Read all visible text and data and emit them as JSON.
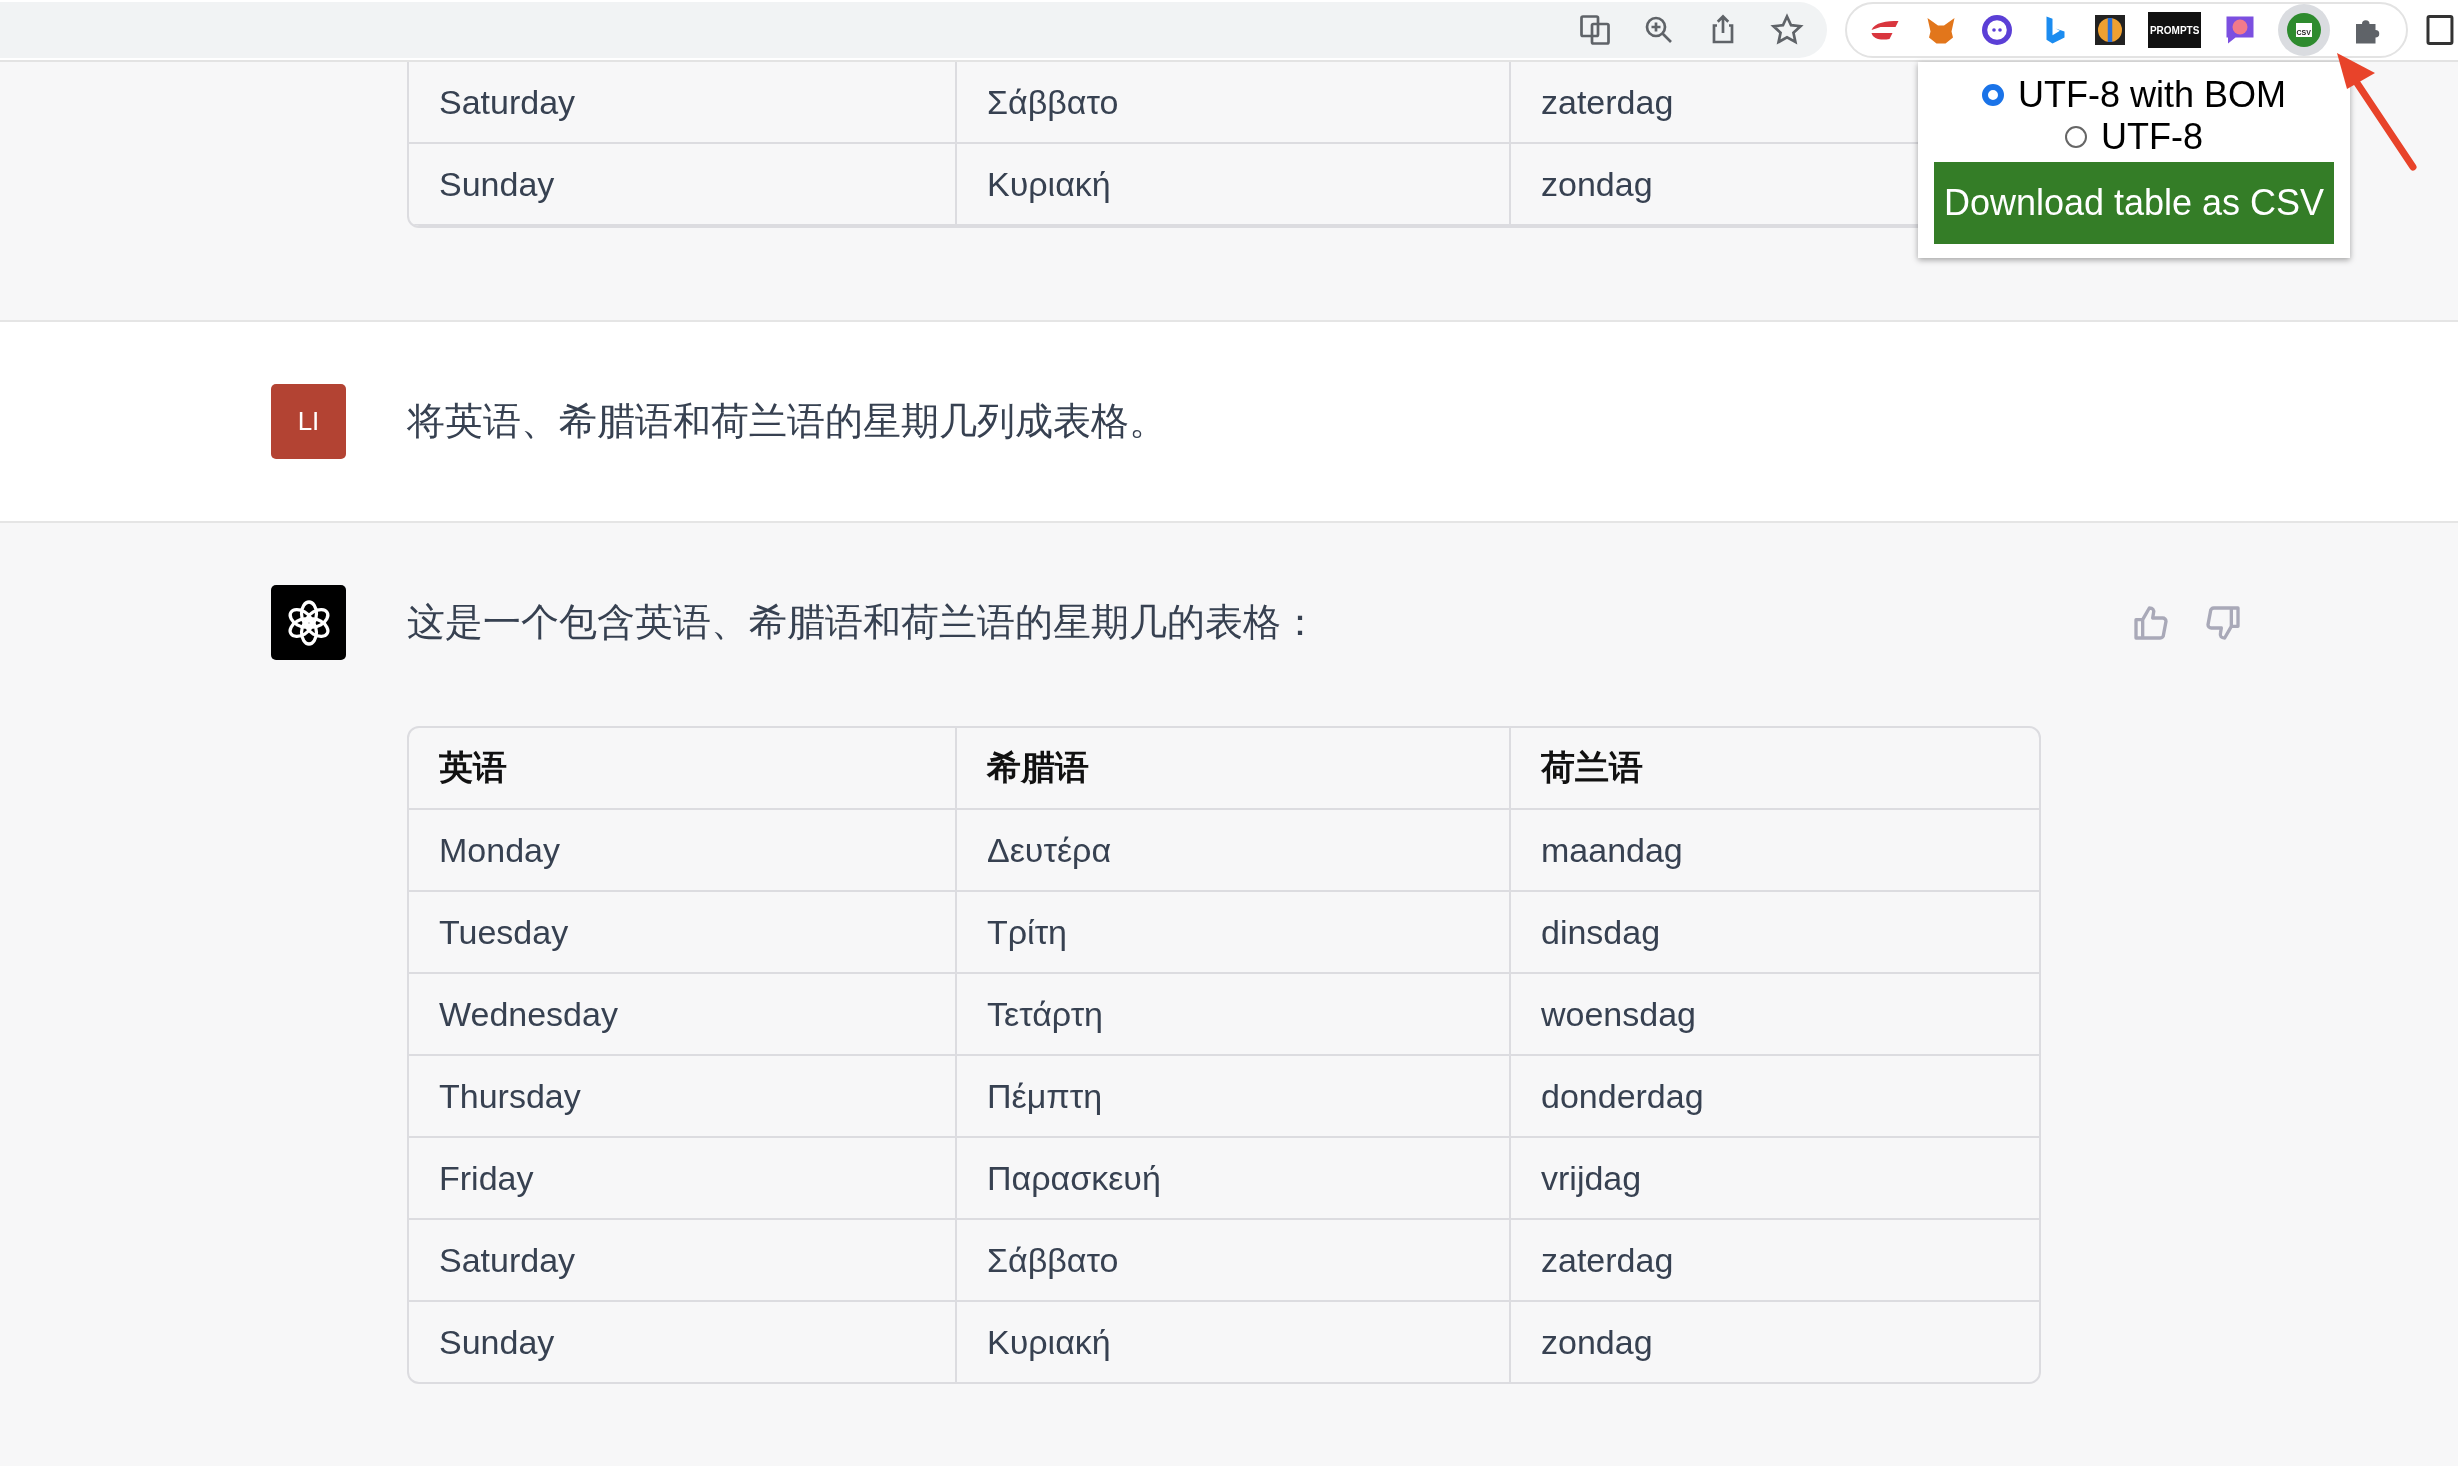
{
  "toolbar": {
    "prompts_label": "PROMPTS",
    "csv_label": "CSV"
  },
  "popup": {
    "options": [
      {
        "label": "UTF-8 with BOM",
        "selected": true
      },
      {
        "label": "UTF-8",
        "selected": false
      }
    ],
    "button": "Download table as CSV"
  },
  "previous_table": {
    "rows": [
      [
        "Saturday",
        "Σάββατο",
        "zaterdag"
      ],
      [
        "Sunday",
        "Κυριακή",
        "zondag"
      ]
    ]
  },
  "user_message": {
    "avatar": "LI",
    "text": "将英语、希腊语和荷兰语的星期几列成表格。"
  },
  "assistant_message": {
    "text": "这是一个包含英语、希腊语和荷兰语的星期几的表格：",
    "table": {
      "columns": [
        "英语",
        "希腊语",
        "荷兰语"
      ],
      "rows": [
        [
          "Monday",
          "Δευτέρα",
          "maandag"
        ],
        [
          "Tuesday",
          "Τρίτη",
          "dinsdag"
        ],
        [
          "Wednesday",
          "Τετάρτη",
          "woensdag"
        ],
        [
          "Thursday",
          "Πέμπτη",
          "donderdag"
        ],
        [
          "Friday",
          "Παρασκευή",
          "vrijdag"
        ],
        [
          "Saturday",
          "Σάββατο",
          "zaterdag"
        ],
        [
          "Sunday",
          "Κυριακή",
          "zondag"
        ]
      ]
    }
  }
}
